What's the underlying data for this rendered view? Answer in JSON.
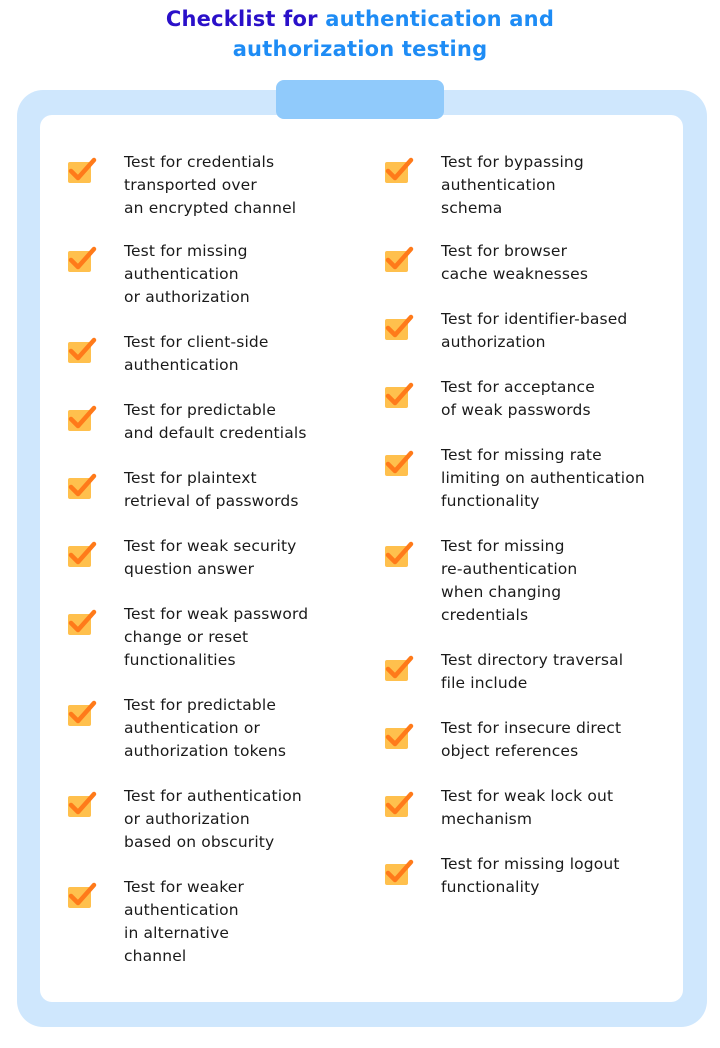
{
  "title": {
    "part1": "Checklist for ",
    "part2": "authentication and",
    "part3": "authorization testing"
  },
  "colors": {
    "title_dark": "#2A10C9",
    "title_light": "#1E8CF5",
    "board": "#CFE7FD",
    "clip": "#90CAFB",
    "checkbox_fill": "#FFC04D",
    "checkmark": "#FF7A1A"
  },
  "icons": {
    "item_icon": "checked-checkbox-icon"
  },
  "left_column": [
    {
      "text": "Test for credentials\ntransported over\nan encrypted channel",
      "checked": true
    },
    {
      "text": "Test for missing\nauthentication\nor authorization",
      "checked": true
    },
    {
      "text": "Test for client-side\nauthentication",
      "checked": true
    },
    {
      "text": "Test for predictable\nand default credentials",
      "checked": true
    },
    {
      "text": "Test for plaintext\nretrieval of passwords",
      "checked": true
    },
    {
      "text": "Test for weak security\nquestion answer",
      "checked": true
    },
    {
      "text": "Test for weak password\nchange or reset\nfunctionalities",
      "checked": true
    },
    {
      "text": "Test for predictable\nauthentication or\nauthorization tokens",
      "checked": true
    },
    {
      "text": "Test for authentication\nor authorization\nbased on obscurity",
      "checked": true
    },
    {
      "text": "Test for weaker\nauthentication\nin alternative\nchannel",
      "checked": true
    }
  ],
  "right_column": [
    {
      "text": "Test for bypassing\nauthentication\nschema",
      "checked": true
    },
    {
      "text": "Test for browser\ncache weaknesses",
      "checked": true
    },
    {
      "text": "Test for identifier-based\nauthorization",
      "checked": true
    },
    {
      "text": "Test for acceptance\nof weak passwords",
      "checked": true
    },
    {
      "text": "Test for missing rate\nlimiting on authentication\nfunctionality",
      "checked": true
    },
    {
      "text": "Test for missing\nre-authentication\nwhen changing\ncredentials",
      "checked": true
    },
    {
      "text": "Test directory traversal\nfile include",
      "checked": true
    },
    {
      "text": "Test for insecure direct\nobject references",
      "checked": true
    },
    {
      "text": "Test for weak lock out\nmechanism",
      "checked": true
    },
    {
      "text": "Test for missing logout\nfunctionality",
      "checked": true
    }
  ]
}
